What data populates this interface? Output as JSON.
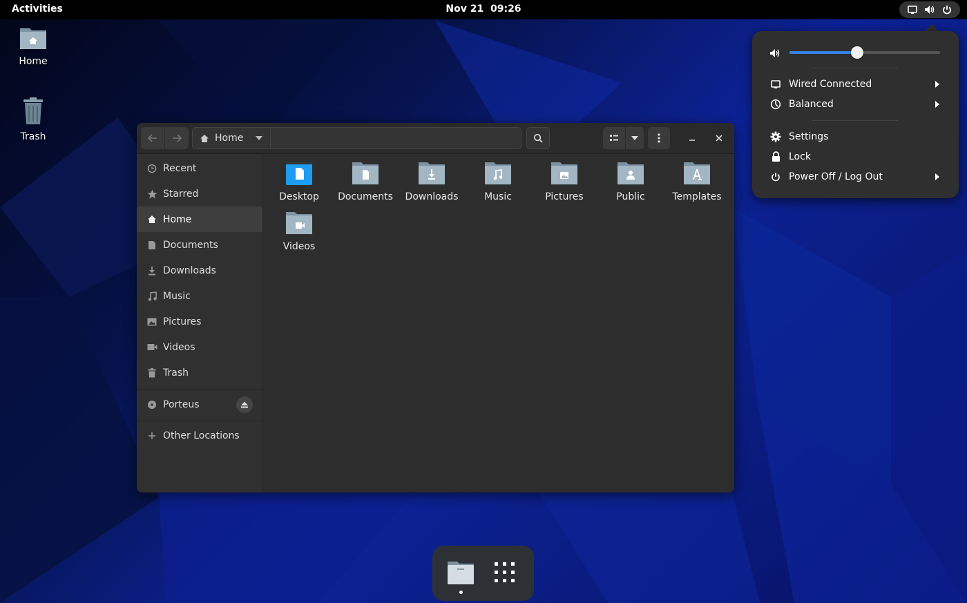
{
  "topbar": {
    "activities": "Activities",
    "clock": "Nov 21  09:26",
    "tray_icons": [
      "network-wired-icon",
      "volume-icon",
      "power-icon"
    ]
  },
  "desktop": {
    "icons": [
      {
        "label": "Home",
        "icon": "home-folder-icon"
      },
      {
        "label": "Trash",
        "icon": "trash-icon"
      }
    ]
  },
  "filemanager": {
    "path": {
      "current": "Home"
    },
    "sidebar": {
      "places": [
        {
          "label": "Recent",
          "icon": "clock-icon"
        },
        {
          "label": "Starred",
          "icon": "star-icon"
        },
        {
          "label": "Home",
          "icon": "home-icon",
          "active": true
        },
        {
          "label": "Documents",
          "icon": "document-icon"
        },
        {
          "label": "Downloads",
          "icon": "download-icon"
        },
        {
          "label": "Music",
          "icon": "music-icon"
        },
        {
          "label": "Pictures",
          "icon": "picture-icon"
        },
        {
          "label": "Videos",
          "icon": "video-icon"
        },
        {
          "label": "Trash",
          "icon": "trash-icon"
        }
      ],
      "devices": [
        {
          "label": "Porteus",
          "icon": "disc-icon"
        }
      ],
      "other": {
        "label": "Other Locations",
        "icon": "plus-icon"
      }
    },
    "files": [
      {
        "label": "Desktop",
        "icon": "desktop-folder-icon"
      },
      {
        "label": "Documents",
        "icon": "documents-folder-icon"
      },
      {
        "label": "Downloads",
        "icon": "downloads-folder-icon"
      },
      {
        "label": "Music",
        "icon": "music-folder-icon"
      },
      {
        "label": "Pictures",
        "icon": "pictures-folder-icon"
      },
      {
        "label": "Public",
        "icon": "public-folder-icon"
      },
      {
        "label": "Templates",
        "icon": "templates-folder-icon"
      },
      {
        "label": "Videos",
        "icon": "videos-folder-icon"
      }
    ]
  },
  "quick_settings": {
    "volume_level": 0.45,
    "items": [
      {
        "label": "Wired Connected",
        "icon": "network-wired-icon",
        "submenu": true
      },
      {
        "label": "Balanced",
        "icon": "power-profile-icon",
        "submenu": true
      },
      {
        "label": "Settings",
        "icon": "gear-icon",
        "submenu": false
      },
      {
        "label": "Lock",
        "icon": "lock-icon",
        "submenu": false
      },
      {
        "label": "Power Off / Log Out",
        "icon": "power-icon",
        "submenu": true
      }
    ]
  },
  "dock": {
    "apps": [
      {
        "name": "files-app-icon",
        "running": true
      },
      {
        "name": "app-grid-icon",
        "running": false
      }
    ]
  },
  "colors": {
    "accent": "#3584e4",
    "folder": "#8fa6b6",
    "desktop_folder": "#1e9cf0"
  }
}
